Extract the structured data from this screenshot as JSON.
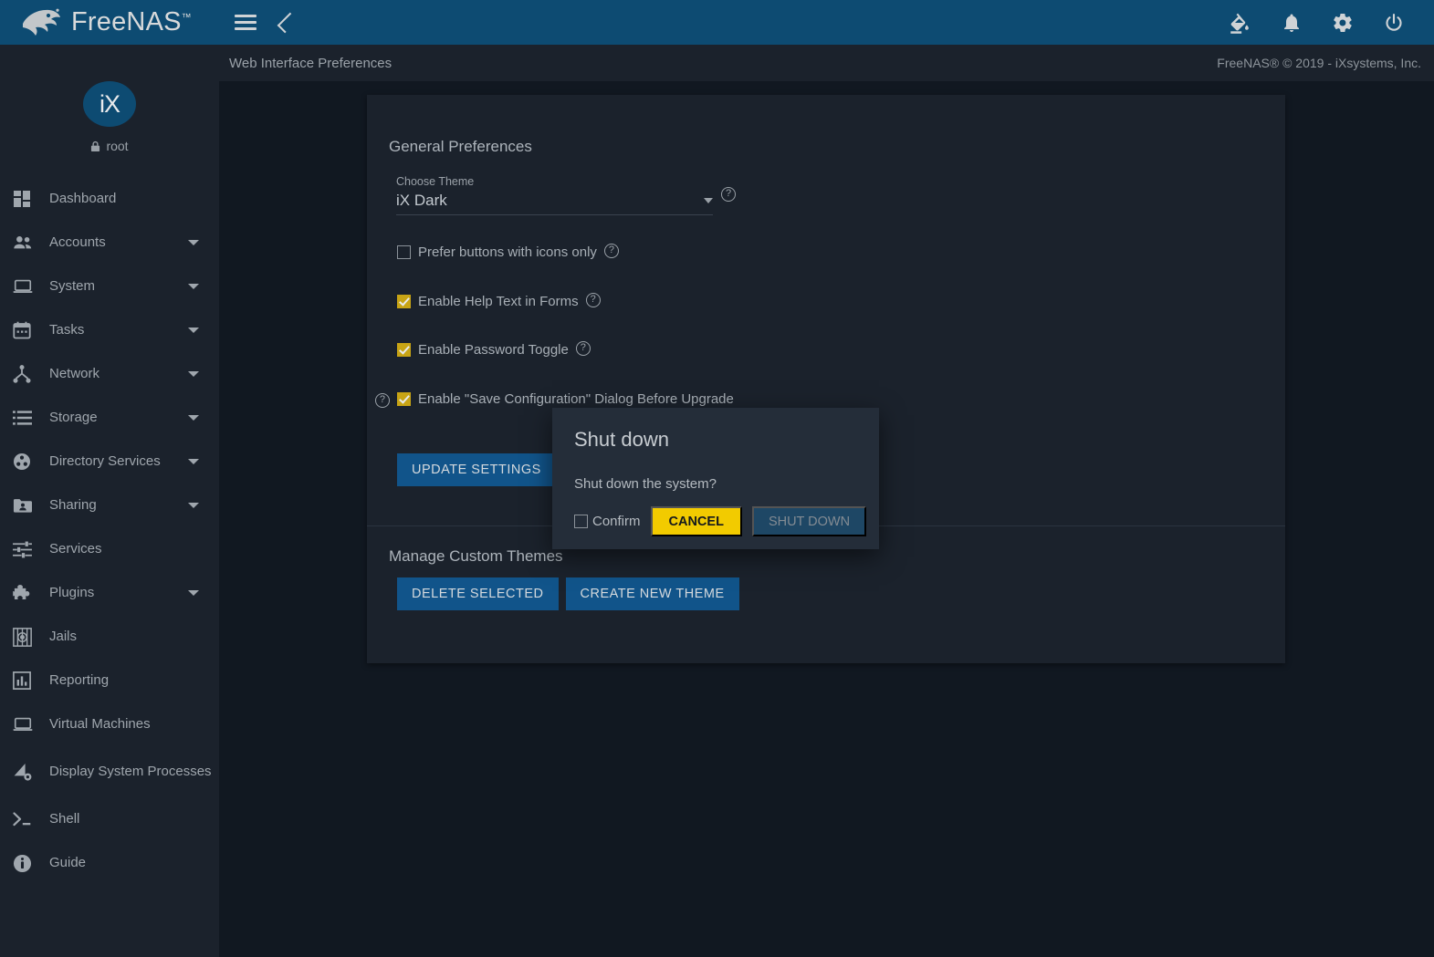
{
  "topbar": {
    "brand": "FreeNAS",
    "brand_tm": "™",
    "menu_icon": "hamburger-icon",
    "back_icon": "chevron-left-icon",
    "right_icons": [
      {
        "name": "theme-paint-icon",
        "title": "Change Theme"
      },
      {
        "name": "notifications-bell-icon",
        "title": "Alerts"
      },
      {
        "name": "settings-gear-icon",
        "title": "Settings"
      },
      {
        "name": "power-icon",
        "title": "Power"
      }
    ],
    "bg_color": "#0d4b72"
  },
  "crumbbar": {
    "title": "Web Interface Preferences",
    "copyright": "FreeNAS® © 2019 - iXsystems, Inc."
  },
  "sidebar": {
    "logo_text": "iX",
    "user": "root",
    "lock_icon": "lock-icon",
    "items": [
      {
        "label": "Dashboard",
        "icon": "dashboard-icon",
        "expandable": false
      },
      {
        "label": "Accounts",
        "icon": "people-icon",
        "expandable": true
      },
      {
        "label": "System",
        "icon": "laptop-icon",
        "expandable": true
      },
      {
        "label": "Tasks",
        "icon": "calendar-icon",
        "expandable": true
      },
      {
        "label": "Network",
        "icon": "network-node-icon",
        "expandable": true
      },
      {
        "label": "Storage",
        "icon": "storage-list-icon",
        "expandable": true
      },
      {
        "label": "Directory Services",
        "icon": "directory-services-icon",
        "expandable": true
      },
      {
        "label": "Sharing",
        "icon": "folder-share-icon",
        "expandable": true
      },
      {
        "label": "Services",
        "icon": "sliders-icon",
        "expandable": false
      },
      {
        "label": "Plugins",
        "icon": "puzzle-piece-icon",
        "expandable": true
      },
      {
        "label": "Jails",
        "icon": "jail-icon",
        "expandable": false
      },
      {
        "label": "Reporting",
        "icon": "bar-chart-icon",
        "expandable": false
      },
      {
        "label": "Virtual Machines",
        "icon": "laptop-icon",
        "expandable": false
      },
      {
        "label": "Display System Processes",
        "icon": "processes-icon",
        "expandable": false
      },
      {
        "label": "Shell",
        "icon": "terminal-prompt-icon",
        "expandable": false
      },
      {
        "label": "Guide",
        "icon": "info-circle-icon",
        "expandable": false
      }
    ]
  },
  "main": {
    "general_preferences_title": "General Preferences",
    "manage_themes_title": "Manage Custom Themes",
    "theme_field": {
      "label": "Choose Theme",
      "value": "iX Dark",
      "help_icon": "help-circle-icon",
      "caret_icon": "chevron-down-icon"
    },
    "checkboxes": [
      {
        "label": "Prefer buttons with icons only",
        "checked": false,
        "help_icon": "help-circle-icon"
      },
      {
        "label": "Enable Help Text in Forms",
        "checked": true,
        "help_icon": "help-circle-icon"
      },
      {
        "label": "Enable Password Toggle",
        "checked": true,
        "help_icon": "help-circle-icon"
      },
      {
        "label": "Enable \"Save Configuration\" Dialog Before Upgrade",
        "checked": true,
        "help_icon": "help-circle-icon"
      }
    ],
    "update_settings_label": "UPDATE SETTINGS",
    "delete_selected_label": "DELETE SELECTED",
    "create_new_theme_label": "CREATE NEW THEME",
    "checkbox_checked_color": "#c8a415",
    "button_color": "#11548a"
  },
  "dialog": {
    "title": "Shut down",
    "message": "Shut down the system?",
    "confirm_label": "Confirm",
    "confirm_checked": false,
    "cancel_label": "CANCEL",
    "shutdown_label": "SHUT DOWN",
    "shutdown_disabled": true,
    "cancel_color": "#f2cb00",
    "shutdown_color": "#1e4765"
  }
}
